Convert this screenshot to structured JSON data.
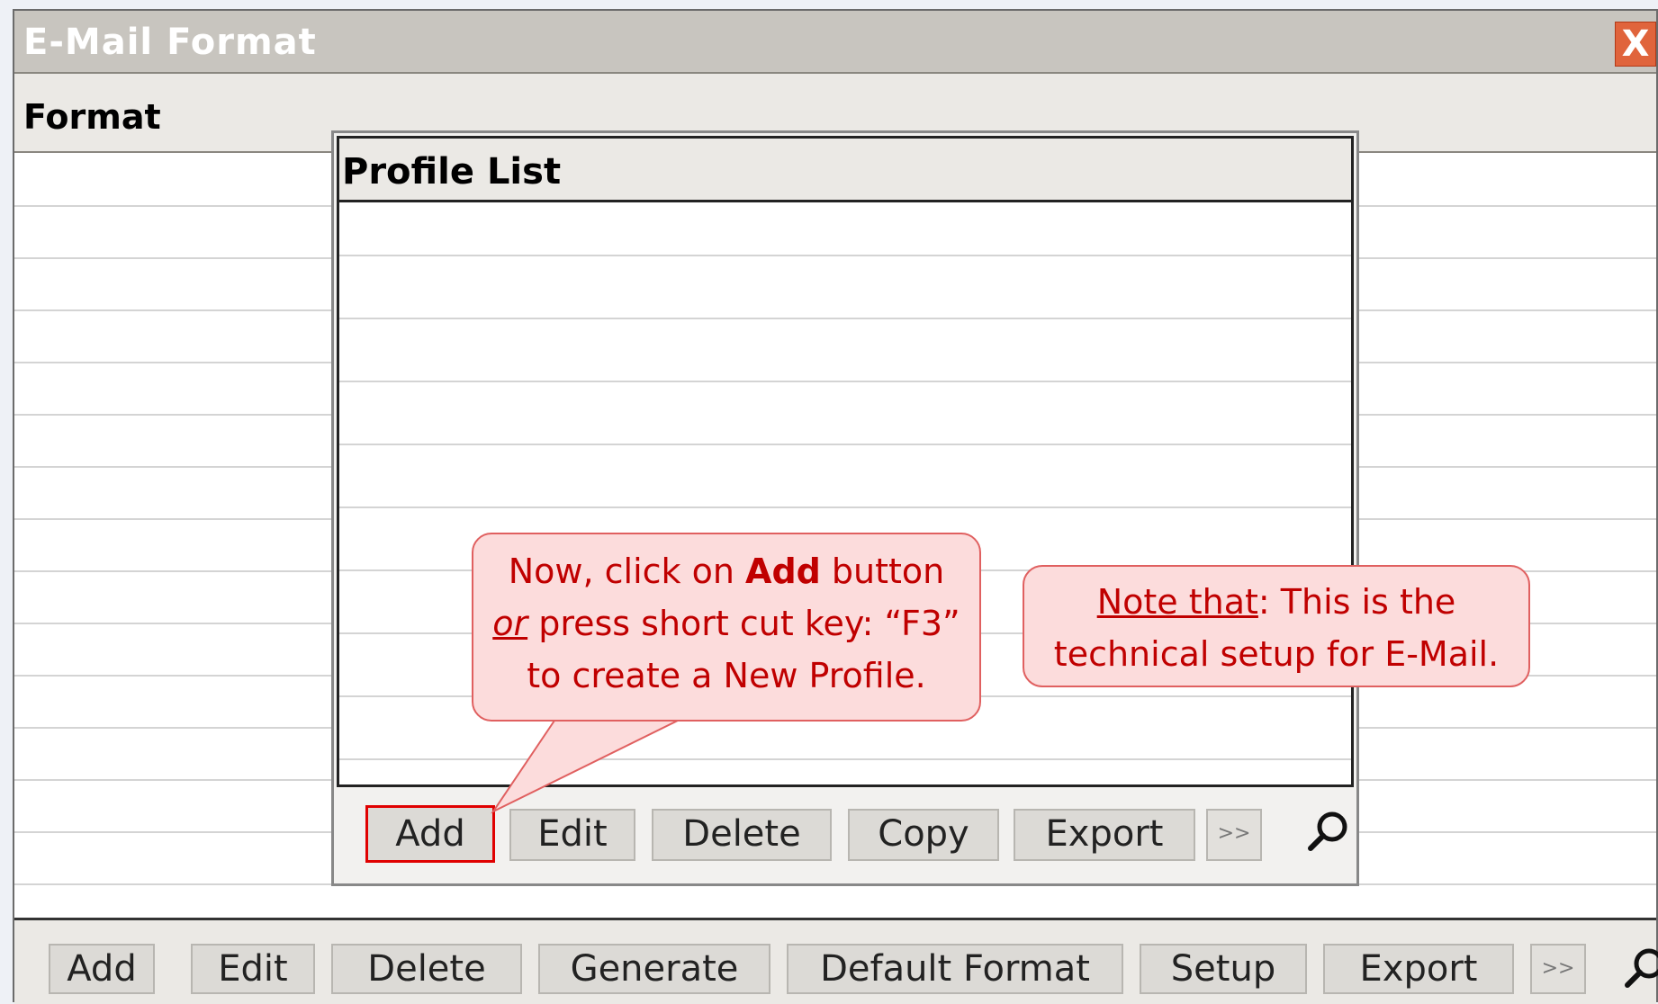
{
  "window": {
    "title": "E-Mail Format",
    "close_label": "X"
  },
  "section": {
    "header": "Format"
  },
  "profile_dialog": {
    "title": "Profile List",
    "buttons": {
      "add": "Add",
      "edit": "Edit",
      "delete": "Delete",
      "copy": "Copy",
      "export": "Export",
      "more": ">>"
    },
    "search_icon": "search-icon"
  },
  "toolbar": {
    "add": "Add",
    "edit": "Edit",
    "delete": "Delete",
    "generate": "Generate",
    "default_format": "Default Format",
    "setup": "Setup",
    "export": "Export",
    "more": ">>",
    "search_icon": "search-icon"
  },
  "callouts": {
    "add_hint": {
      "line1_pre": "Now, click on ",
      "line1_bold": "Add",
      "line1_post": " button",
      "line2_italic": "or",
      "line2_post": " press short cut key: “F3”",
      "line3": "to create a New Profile."
    },
    "note": {
      "label": "Note that",
      "line1_post": ": This is the",
      "line2": "technical setup for E-Mail."
    }
  },
  "colors": {
    "callout_fill": "#fcdcdc",
    "callout_text": "#c00000",
    "highlight": "#e00000",
    "titlebar": "#c8c5bf"
  }
}
